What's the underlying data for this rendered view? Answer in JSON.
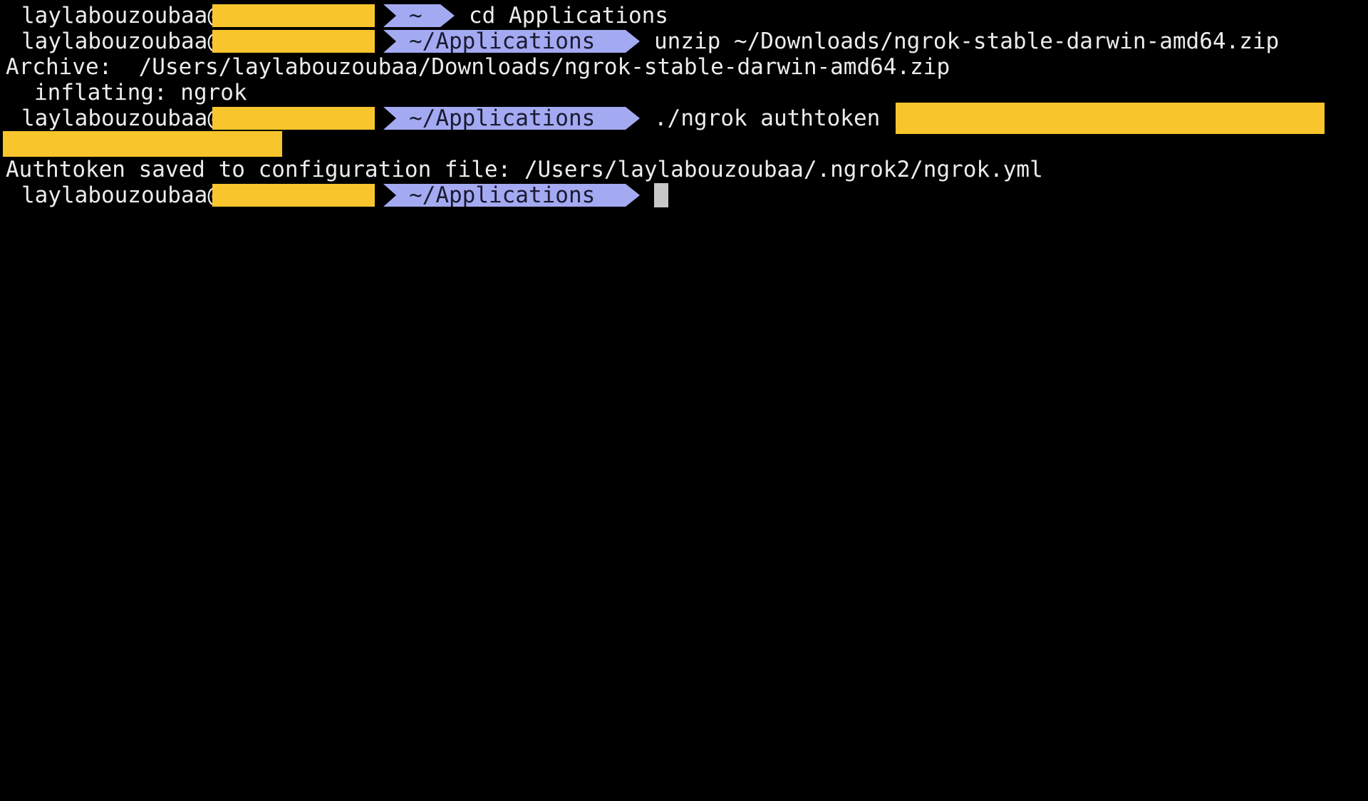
{
  "prompt": {
    "user": "laylabouzoubaa@",
    "home_dir": "~",
    "apps_dir": "~/Applications"
  },
  "lines": {
    "l1_cmd": "cd Applications",
    "l2_cmd": "unzip ~/Downloads/ngrok-stable-darwin-amd64.zip",
    "l3_output": "Archive:  /Users/laylabouzoubaa/Downloads/ngrok-stable-darwin-amd64.zip",
    "l4_output": "inflating: ngrok",
    "l5_cmd": "./ngrok authtoken",
    "l6_output": "Authtoken saved to configuration file: /Users/laylabouzoubaa/.ngrok2/ngrok.yml"
  },
  "colors": {
    "background": "#000000",
    "text": "#ececec",
    "redaction": "#f8c52c",
    "dir_segment": "#a4aaf2",
    "cursor": "#c8c8c8"
  }
}
